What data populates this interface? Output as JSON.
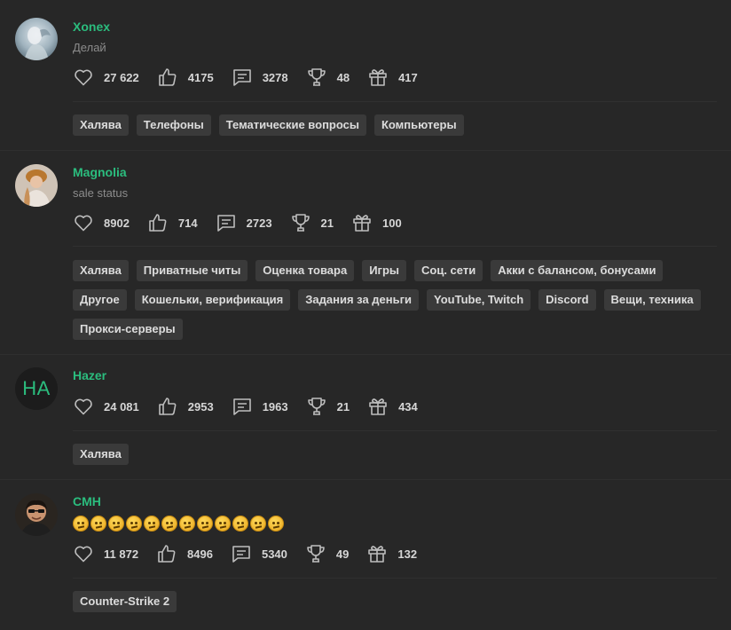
{
  "users": [
    {
      "name": "Xonex",
      "status": "Делай",
      "avatar": "photo",
      "stats": {
        "likes": "27 622",
        "thumbs": "4175",
        "messages": "3278",
        "trophies": "48",
        "gifts": "417"
      },
      "tags": [
        "Халява",
        "Телефоны",
        "Тематические вопросы",
        "Компьютеры"
      ]
    },
    {
      "name": "Magnolia",
      "status": "sale status",
      "avatar": "photo",
      "stats": {
        "likes": "8902",
        "thumbs": "714",
        "messages": "2723",
        "trophies": "21",
        "gifts": "100"
      },
      "tags": [
        "Халява",
        "Приватные читы",
        "Оценка товара",
        "Игры",
        "Соц. сети",
        "Акки с балансом, бонусами",
        "Другое",
        "Кошельки, верификация",
        "Задания за деньги",
        "YouTube, Twitch",
        "Discord",
        "Вещи, техника",
        "Прокси-серверы"
      ]
    },
    {
      "name": "Hazer",
      "avatar_initials": "HA",
      "stats": {
        "likes": "24 081",
        "thumbs": "2953",
        "messages": "1963",
        "trophies": "21",
        "gifts": "434"
      },
      "tags": [
        "Халява"
      ]
    },
    {
      "name": "CMH",
      "status_emoji": "thinking-face-emoji",
      "status_emoji_count": 12,
      "avatar": "photo",
      "stats": {
        "likes": "11 872",
        "thumbs": "8496",
        "messages": "5340",
        "trophies": "49",
        "gifts": "132"
      },
      "tags": [
        "Counter-Strike 2"
      ]
    }
  ],
  "icons": {
    "likes": "heart-icon",
    "thumbs": "thumbs-up-icon",
    "messages": "message-icon",
    "trophies": "trophy-icon",
    "gifts": "gift-icon"
  },
  "colors": {
    "background": "#272727",
    "username": "#2bbd7e",
    "tag_bg": "#3a3a3a",
    "status_text": "#8c8c8c"
  }
}
